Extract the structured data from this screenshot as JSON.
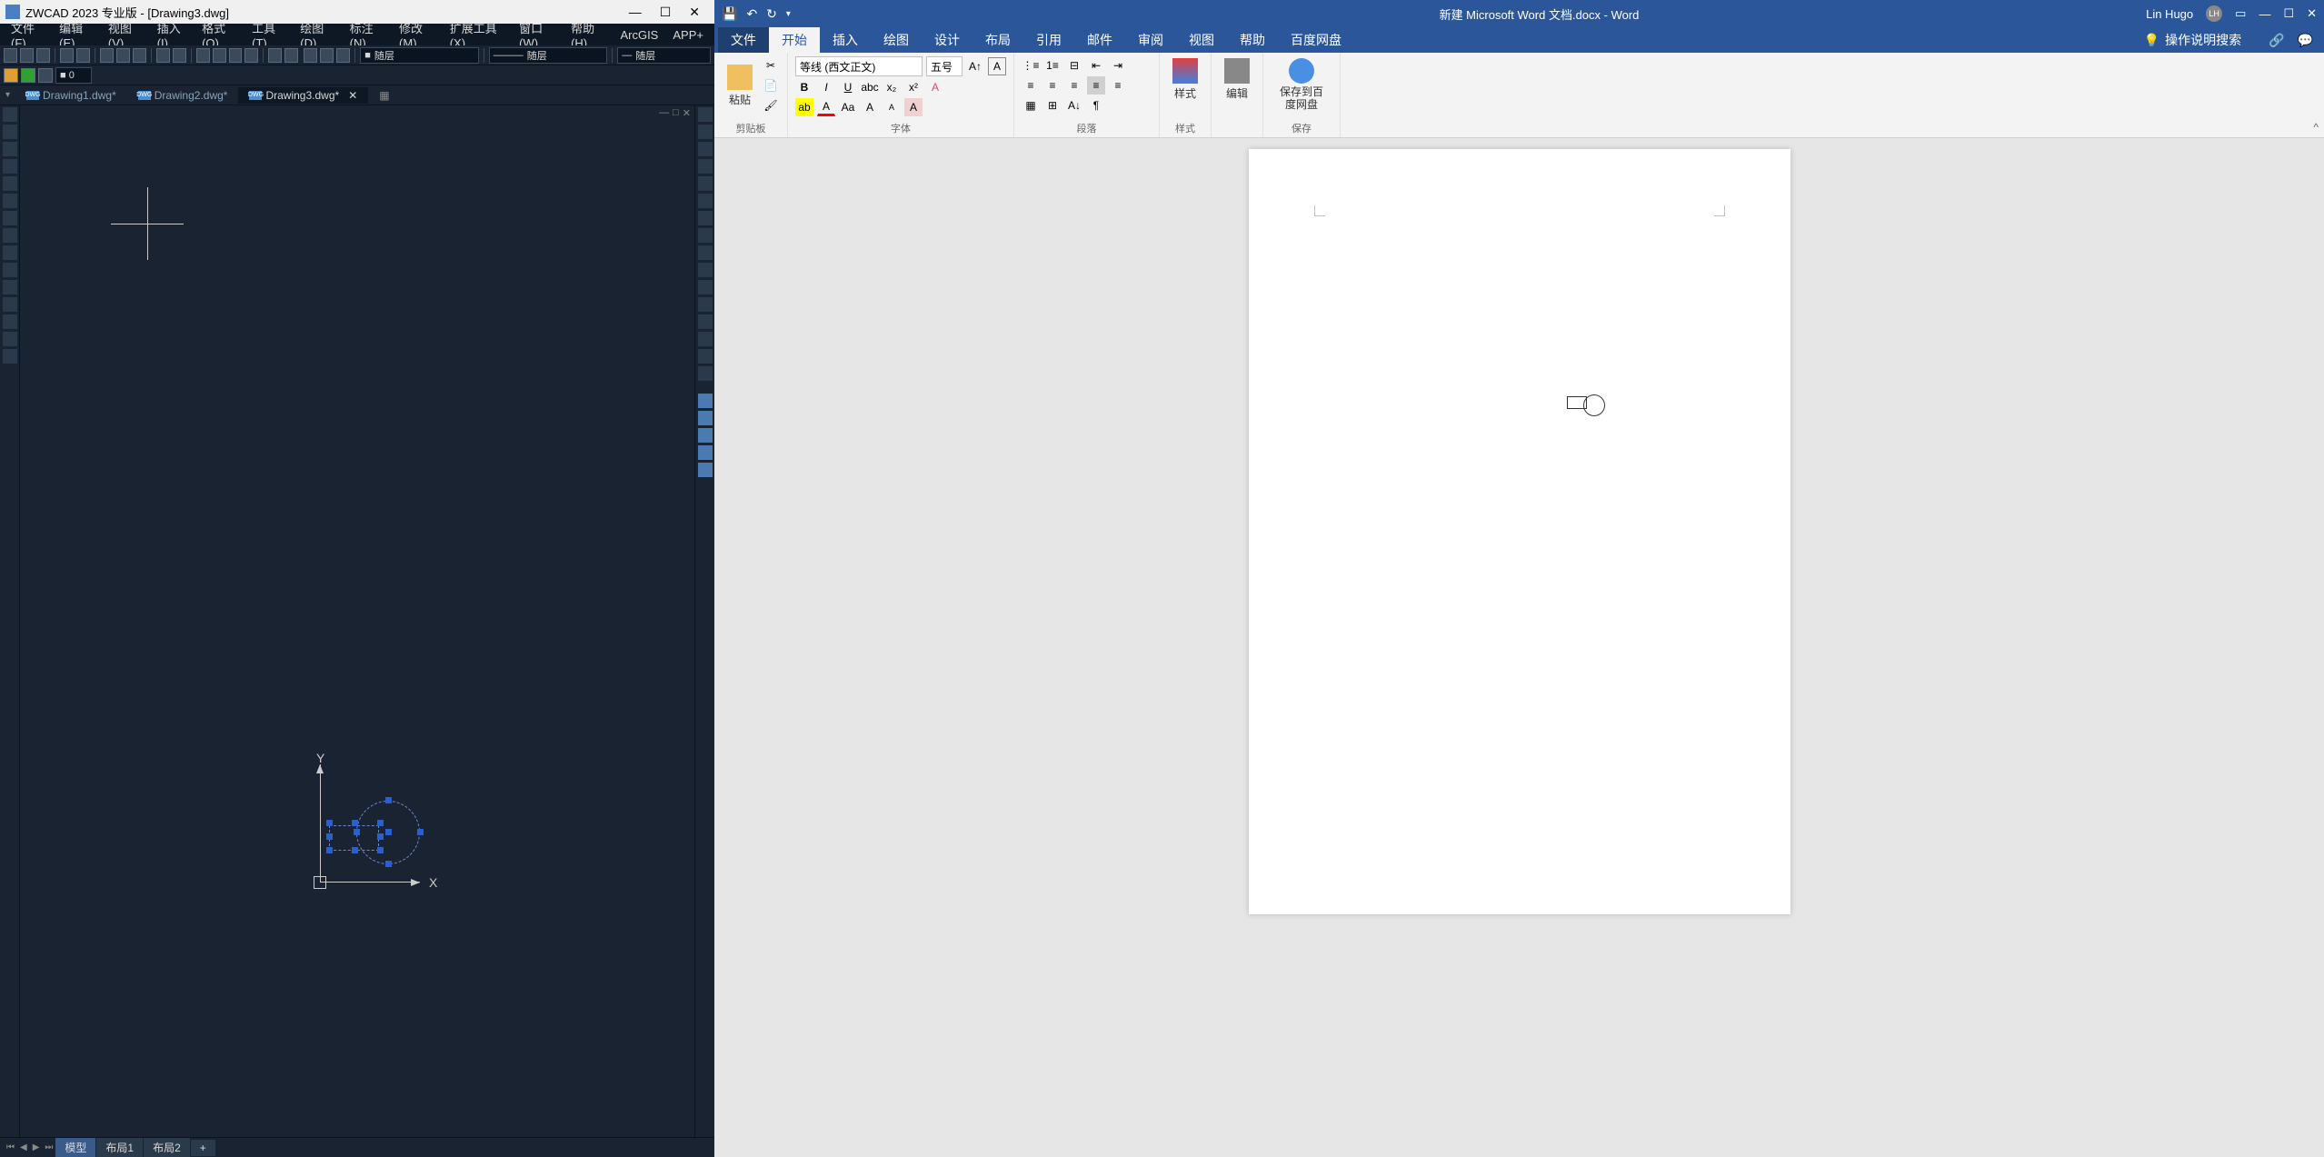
{
  "zwcad": {
    "title": "ZWCAD 2023 专业版 - [Drawing3.dwg]",
    "menubar": [
      "文件(F)",
      "编辑(E)",
      "视图(V)",
      "插入(I)",
      "格式(O)",
      "工具(T)",
      "绘图(D)",
      "标注(N)",
      "修改(M)",
      "扩展工具(X)",
      "窗口(W)",
      "帮助(H)",
      "ArcGIS",
      "APP+"
    ],
    "layer_dropdown": "随层",
    "linetype_dropdown": "随层",
    "lineweight_dropdown": "随层",
    "tabs": [
      {
        "name": "Drawing1.dwg*",
        "active": false
      },
      {
        "name": "Drawing2.dwg*",
        "active": false
      },
      {
        "name": "Drawing3.dwg*",
        "active": true
      }
    ],
    "axis_x": "X",
    "axis_y": "Y",
    "layout_tabs": {
      "model": "模型",
      "layout1": "布局1",
      "layout2": "布局2",
      "add": "+"
    }
  },
  "word": {
    "doc_title": "新建 Microsoft Word 文档.docx - Word",
    "user": "Lin Hugo",
    "user_initials": "LH",
    "ribbon_tabs": [
      "文件",
      "开始",
      "插入",
      "绘图",
      "设计",
      "布局",
      "引用",
      "邮件",
      "审阅",
      "视图",
      "帮助",
      "百度网盘"
    ],
    "tell_me": "操作说明搜索",
    "groups": {
      "clipboard": "剪贴板",
      "paste": "粘贴",
      "font": "字体",
      "font_name": "等线 (西文正文)",
      "font_size": "五号",
      "paragraph": "段落",
      "styles": "样式",
      "styles_btn": "样式",
      "editing": "编辑",
      "baidu": "保存到百度网盘",
      "baidu_group": "保存"
    }
  }
}
